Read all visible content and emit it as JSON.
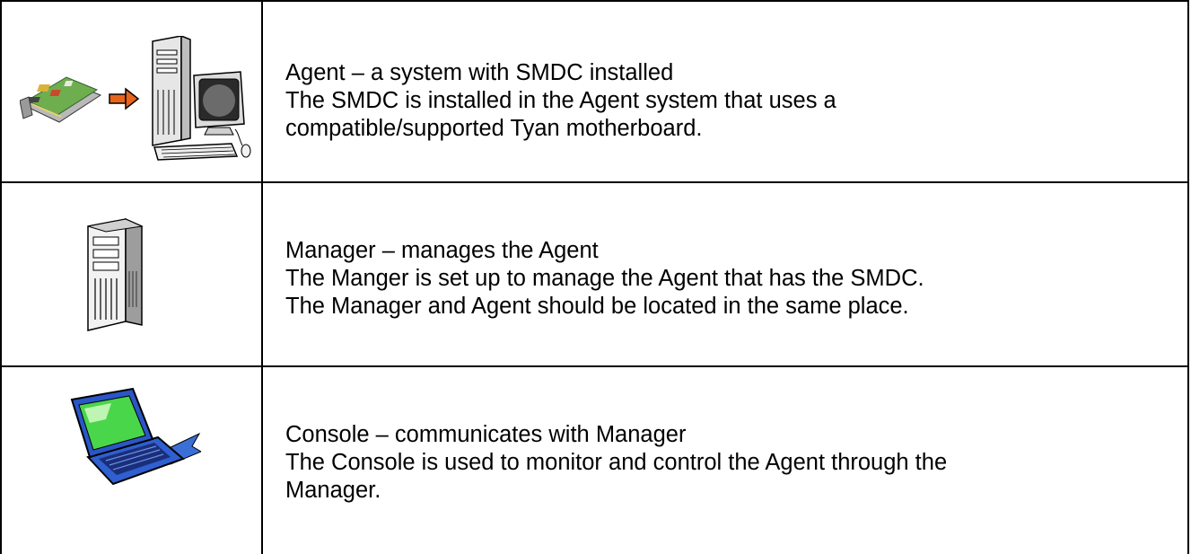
{
  "rows": [
    {
      "id": "agent",
      "icons": [
        "circuit-board-icon",
        "arrow-right-icon",
        "desktop-computer-icon"
      ],
      "heading": "Agent – a system with SMDC installed",
      "lines": [
        "The SMDC is installed in the Agent system that uses a",
        "compatible/supported Tyan motherboard."
      ]
    },
    {
      "id": "manager",
      "icons": [
        "server-tower-icon"
      ],
      "heading": "Manager – manages the Agent",
      "lines": [
        "The Manger is set up to manage the Agent that has the SMDC.",
        "The Manager and Agent should be located in the same place."
      ]
    },
    {
      "id": "console",
      "icons": [
        "laptop-icon"
      ],
      "heading": "Console – communicates with Manager",
      "lines": [
        "The Console is used to monitor and control the Agent through the",
        "Manager."
      ]
    }
  ]
}
